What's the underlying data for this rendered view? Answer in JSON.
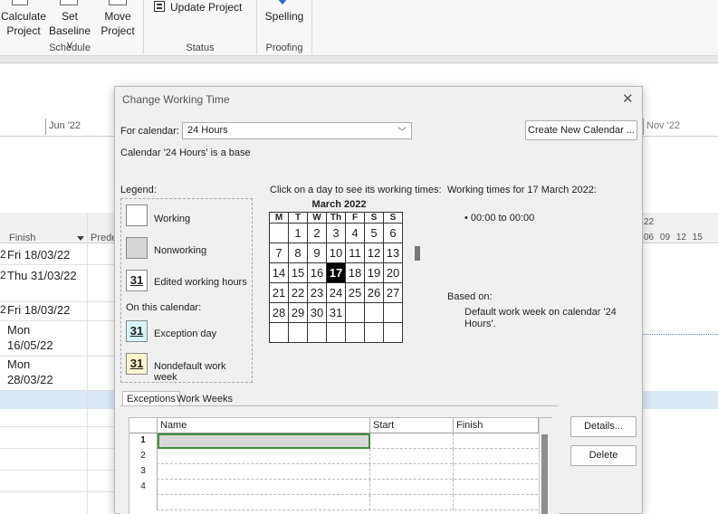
{
  "ribbon": {
    "calculate_line1": "Calculate",
    "calculate_line2": "Project",
    "set_baseline_line1": "Set",
    "set_baseline_line2": "Baseline ˅",
    "move_line1": "Move",
    "move_line2": "Project",
    "update_project": "Update Project",
    "spelling": "Spelling",
    "groups": {
      "schedule": "Schedule",
      "status": "Status",
      "proofing": "Proofing"
    }
  },
  "timescale": {
    "jun": "Jun '22",
    "nov": "Nov '22",
    "right_month": "22",
    "right_days": [
      "06",
      "09",
      "12",
      "15"
    ]
  },
  "table": {
    "header_finish": "Finish",
    "header_pred": "Prede",
    "rows": [
      {
        "mark": "2",
        "finish": "Fri 18/03/22"
      },
      {
        "mark": "2",
        "finish": "Thu 31/03/22"
      },
      {
        "mark": "2",
        "finish": "Fri 18/03/22"
      },
      {
        "mark": "",
        "finish": "Mon 16/05/22"
      },
      {
        "mark": "",
        "finish": "Mon 28/03/22"
      }
    ]
  },
  "dialog": {
    "title": "Change Working Time",
    "for_calendar_label": "For calendar:",
    "for_calendar_value": "24 Hours",
    "create_new_calendar": "Create New Calendar ...",
    "calendar_desc": "Calendar '24 Hours' is a base",
    "legend_label": "Legend:",
    "legend": {
      "working": "Working",
      "nonworking": "Nonworking",
      "edited_hours": "Edited working hours",
      "on_this_calendar": "On this calendar:",
      "exception_day": "Exception day",
      "nondefault_week": "Nondefault work week",
      "num": "31"
    },
    "click_instructions": "Click on a day to see its working times:",
    "calendar": {
      "month": "March 2022",
      "day_headers": [
        "M",
        "T",
        "W",
        "Th",
        "F",
        "S",
        "S"
      ],
      "weeks": [
        [
          "",
          "1",
          "2",
          "3",
          "4",
          "5",
          "6"
        ],
        [
          "7",
          "8",
          "9",
          "10",
          "11",
          "12",
          "13"
        ],
        [
          "14",
          "15",
          "16",
          "17",
          "18",
          "19",
          "20"
        ],
        [
          "21",
          "22",
          "23",
          "24",
          "25",
          "26",
          "27"
        ],
        [
          "28",
          "29",
          "30",
          "31",
          "",
          "",
          ""
        ],
        [
          "",
          "",
          "",
          "",
          "",
          "",
          ""
        ]
      ],
      "selected_day": "17"
    },
    "working_times_title": "Working times for 17 March 2022:",
    "working_times_item": "• 00:00 to 00:00",
    "based_on_label": "Based on:",
    "based_on_text": "Default work week on calendar '24 Hours'.",
    "tabs": {
      "exceptions": "Exceptions",
      "work_weeks": "Work Weeks"
    },
    "grid": {
      "headers": {
        "name": "Name",
        "start": "Start",
        "finish": "Finish"
      },
      "row_numbers": [
        "1",
        "2",
        "3",
        "4"
      ]
    },
    "details_button": "Details...",
    "delete_button": "Delete"
  }
}
